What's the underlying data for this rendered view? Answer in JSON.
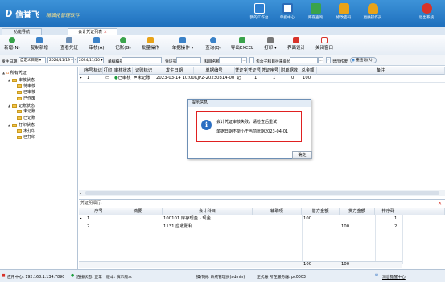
{
  "app": {
    "logo_glyph": "ʋ",
    "brand": "信誉飞",
    "slogan": "精细化管理软件"
  },
  "header_buttons": [
    {
      "label": "我的工作台",
      "icon": "monitor-icon",
      "color": "#2d7fd0"
    },
    {
      "label": "单据中心",
      "icon": "document-icon",
      "color": "#2b6cb8"
    },
    {
      "label": "库存查询",
      "icon": "edit-icon",
      "color": "#3aa34c"
    },
    {
      "label": "修改密码",
      "icon": "lock-icon",
      "color": "#e8a318"
    },
    {
      "label": "更换操作员",
      "icon": "user-icon",
      "color": "#e8a318"
    },
    {
      "label": "退出系统",
      "icon": "exit-icon",
      "color": "#d8332a"
    }
  ],
  "tabs": [
    {
      "label": "功能导航"
    },
    {
      "label": "会计凭证列表",
      "close": "×"
    }
  ],
  "toolbar": [
    {
      "label": "新增(N)",
      "icon": "add-icon",
      "color": "#36a24a"
    },
    {
      "label": "复制新增",
      "icon": "copy-add-icon",
      "color": "#3b82c8"
    },
    {
      "label": "查看凭证",
      "icon": "view-icon",
      "color": "#6d8fb5"
    },
    {
      "label": "审核(A)",
      "icon": "audit-icon",
      "color": "#3b82c8"
    },
    {
      "label": "记账(G)",
      "icon": "post-icon",
      "color": "#3aa34c"
    },
    {
      "label": "批量操作",
      "icon": "batch-icon",
      "color": "#e8a318"
    },
    {
      "label": "单据操作 ▾",
      "icon": "bill-icon",
      "color": "#3b82c8"
    },
    {
      "label": "查询(Q)",
      "icon": "query-icon",
      "color": "#3b82c8"
    },
    {
      "label": "导出EXCEL",
      "icon": "export-icon",
      "color": "#3aa34c"
    },
    {
      "label": "打印 ▾",
      "icon": "print-icon",
      "color": "#777777"
    },
    {
      "label": "界面设计",
      "icon": "design-icon",
      "color": "#d8332a"
    },
    {
      "label": "关闭窗口",
      "icon": "close-window-icon",
      "color": "#d8332a"
    }
  ],
  "filter": {
    "date_label": "发生日期",
    "period": "自定义日期 ▾",
    "date_from": "2024/11/19 ▾",
    "to": "-",
    "date_to": "2024/11/20 ▾",
    "voucher_no_label": "单据编号",
    "voucher_label": "凭证号",
    "account_label": "科目名称",
    "dots": "...",
    "include_sub": "包含子科目",
    "unit_label": "往来单位",
    "show_void": "显示作废",
    "refresh": "重查询(R)"
  },
  "tree": [
    {
      "label": "所有凭证",
      "level": 0,
      "toggle": "▲"
    },
    {
      "label": "审核状态",
      "level": 1,
      "toggle": "▲"
    },
    {
      "label": "待审核",
      "level": 2
    },
    {
      "label": "已审核",
      "level": 2
    },
    {
      "label": "已作废",
      "level": 2
    },
    {
      "label": "记账状态",
      "level": 1,
      "toggle": "▲"
    },
    {
      "label": "未记账",
      "level": 2
    },
    {
      "label": "已记账",
      "level": 2
    },
    {
      "label": "打印状态",
      "level": 1,
      "toggle": "▲"
    },
    {
      "label": "未打印",
      "level": 2
    },
    {
      "label": "已打印",
      "level": 2
    }
  ],
  "main_grid": {
    "headers": [
      "序号",
      "标记",
      "打印",
      "审核状态",
      "记账标记",
      "发生日期",
      "单据编号",
      "凭证字",
      "凭证号",
      "凭证序号",
      "附单据数",
      "总金额",
      "备注"
    ],
    "rows": [
      {
        "marker": "▸",
        "no": "1",
        "mark": "",
        "print": "▭",
        "audit": "已审核",
        "post": "未记账",
        "date": "2023-03-14 10:00",
        "bill_no": "KJPZ-20230314-00",
        "word": "记",
        "vno": "1",
        "seq": "1",
        "attach": "0",
        "total": "100",
        "memo": ""
      }
    ]
  },
  "detail": {
    "caption": "凭证明细行:",
    "close": "✕",
    "headers": [
      "序号",
      "摘要",
      "会计科目",
      "辅助项",
      "借方金额",
      "贷方金额",
      "排序码"
    ],
    "rows": [
      {
        "marker": "▸",
        "no": "1",
        "summary": "",
        "account": "100101 库存现金 - 现金",
        "aux": "",
        "debit": "100",
        "credit": "",
        "sort": "1"
      },
      {
        "marker": "",
        "no": "2",
        "summary": "",
        "account": "1131 应收账利",
        "aux": "",
        "debit": "",
        "credit": "100",
        "sort": "2"
      }
    ],
    "totals": {
      "debit": "100",
      "credit": "100"
    }
  },
  "dialog": {
    "title": "提示信息",
    "icon_glyph": "i",
    "line1": "会计凭证审核失败，请检查后重试！",
    "line2": "单据日期不能小于当前账期2023-04-01",
    "ok": "确定"
  },
  "status": {
    "app_center": "应用中心: 192.168.1.134:7890",
    "conn": "连接状态: 正常",
    "version": "版本: 演示版本",
    "operator": "操作员: 系统管理员(admin)",
    "account": "正式账 所在服务器: pc0003",
    "message": "消息提醒中心"
  }
}
